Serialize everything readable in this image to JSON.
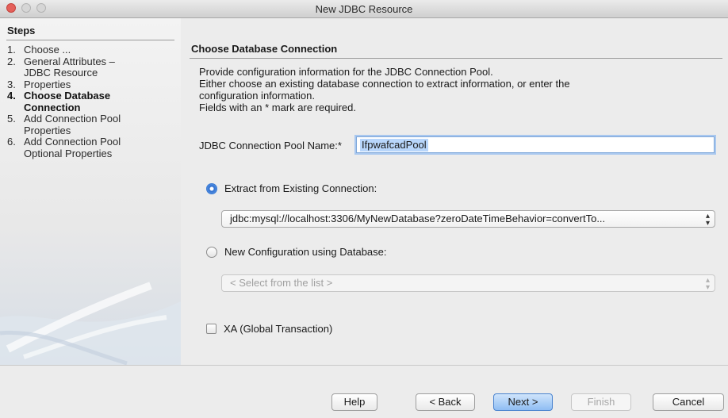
{
  "window": {
    "title": "New JDBC Resource"
  },
  "steps": {
    "title": "Steps",
    "items": [
      {
        "num": "1.",
        "lines": [
          "Choose ..."
        ]
      },
      {
        "num": "2.",
        "lines": [
          "General Attributes –",
          "JDBC Resource"
        ]
      },
      {
        "num": "3.",
        "lines": [
          "Properties"
        ]
      },
      {
        "num": "4.",
        "lines": [
          "Choose Database",
          "Connection"
        ],
        "current": true
      },
      {
        "num": "5.",
        "lines": [
          "Add Connection Pool",
          "Properties"
        ]
      },
      {
        "num": "6.",
        "lines": [
          "Add Connection Pool",
          "Optional Properties"
        ]
      }
    ]
  },
  "content": {
    "title": "Choose Database Connection",
    "description": [
      "Provide configuration information for the JDBC Connection Pool.",
      "Either choose an existing database connection to extract information, or enter the",
      "configuration information.",
      "Fields with an * mark are required."
    ],
    "pool_label": "JDBC Connection Pool Name:*",
    "pool_value": "IfpwafcadPool",
    "extract_label": "Extract from Existing Connection:",
    "extract_selected": true,
    "connection_value": "jdbc:mysql://localhost:3306/MyNewDatabase?zeroDateTimeBehavior=convertTo...",
    "newconfig_label": "New Configuration using Database:",
    "newconfig_selected": false,
    "database_placeholder": "< Select from the list >",
    "xa_label": "XA (Global Transaction)",
    "xa_checked": false
  },
  "buttons": {
    "help": "Help",
    "back": "< Back",
    "next": "Next >",
    "finish": "Finish",
    "cancel": "Cancel"
  },
  "colors": {
    "accent": "#3b7bd4",
    "default_button": "#8fbdf3"
  }
}
